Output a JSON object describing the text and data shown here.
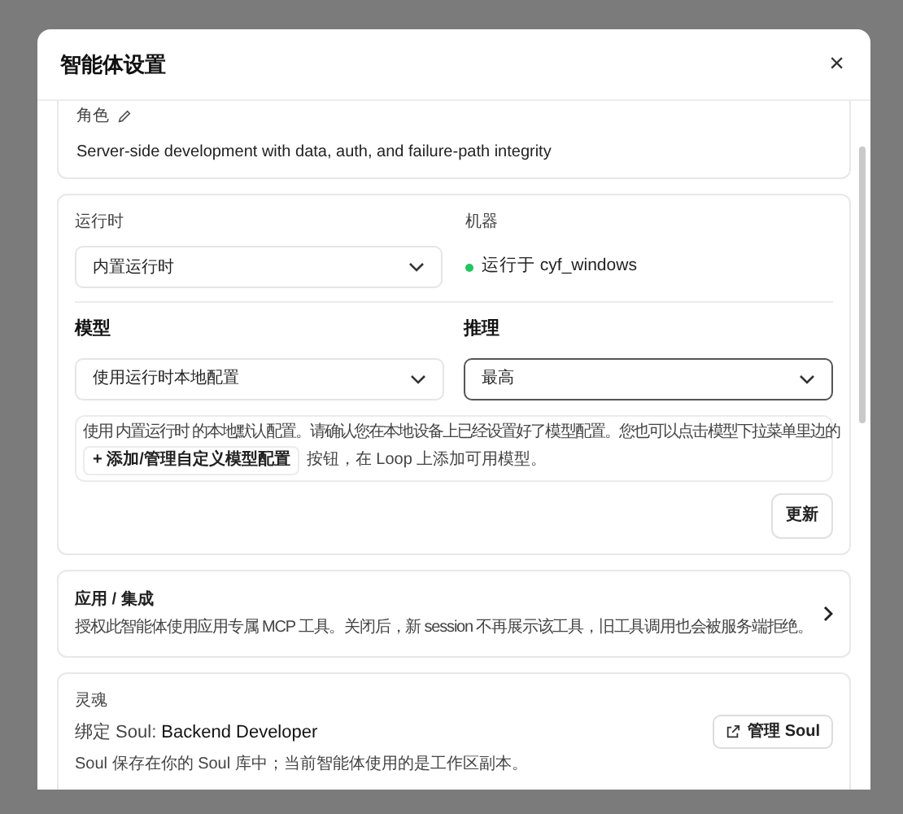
{
  "dialog": {
    "title": "智能体设置",
    "close": "×"
  },
  "role": {
    "label": "角色",
    "description": "Server-side development with data, auth, and failure-path integrity"
  },
  "runtime": {
    "label": "运行时",
    "value": "内置运行时",
    "machine_label": "机器",
    "machine_status": "运行于 cyf_windows",
    "online": true
  },
  "model": {
    "label": "模型",
    "value": "使用运行时本地配置",
    "focused": false
  },
  "reasoning": {
    "label": "推理",
    "value": "最高",
    "focused": true
  },
  "info": {
    "text_before": "使用 内置运行时 的本地默认配置。请确认您在本地设备上已经设置好了模型配置。您也可以点击模型下拉菜单里边的",
    "button": "+ 添加/管理自定义模型配置",
    "text_after": "按钮，在 Loop 上添加可用模型。"
  },
  "update_button": "更新",
  "integrations": {
    "title": "应用 / 集成",
    "description": "授权此智能体使用应用专属 MCP 工具。关闭后，新 session 不再展示该工具，旧工具调用也会被服务端拒绝。"
  },
  "soul": {
    "label": "灵魂",
    "binding_prefix": "绑定 Soul:",
    "binding_name": "Backend Developer",
    "note": "Soul 保存在你的 Soul 库中；当前智能体使用的是工作区副本。",
    "manage_button": "管理 Soul"
  }
}
